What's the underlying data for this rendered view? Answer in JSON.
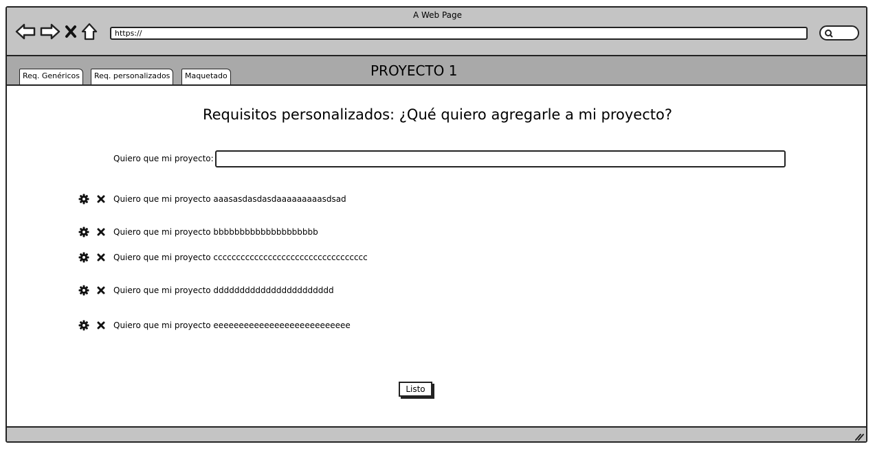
{
  "window": {
    "title": "A Web Page"
  },
  "browser": {
    "url": "https://",
    "icons": [
      "back-arrow-icon",
      "forward-arrow-icon",
      "close-icon",
      "home-icon",
      "search-icon"
    ]
  },
  "tabs": [
    {
      "label": "Req. Genéricos"
    },
    {
      "label": "Req. personalizados"
    },
    {
      "label": "Maquetado"
    }
  ],
  "project": {
    "title": "PROYECTO 1"
  },
  "main": {
    "heading": "Requisitos personalizados: ¿Qué quiero agregarle a mi proyecto?",
    "input_label": "Quiero que mi proyecto:",
    "input_value": "",
    "requirements": [
      {
        "text": "Quiero que mi proyecto aaasasdasdasdaaaaaaaaasdsad"
      },
      {
        "text": "Quiero que mi proyecto bbbbbbbbbbbbbbbbbbbb"
      },
      {
        "text": "Quiero que mi proyecto cccccccccccccccccccccccccccccccccc"
      },
      {
        "text": "Quiero que mi proyecto ddddddddddddddddddddddd"
      },
      {
        "text": "Quiero que mi proyecto eeeeeeeeeeeeeeeeeeeeeeeeeee"
      }
    ],
    "done_label": "Listo"
  }
}
